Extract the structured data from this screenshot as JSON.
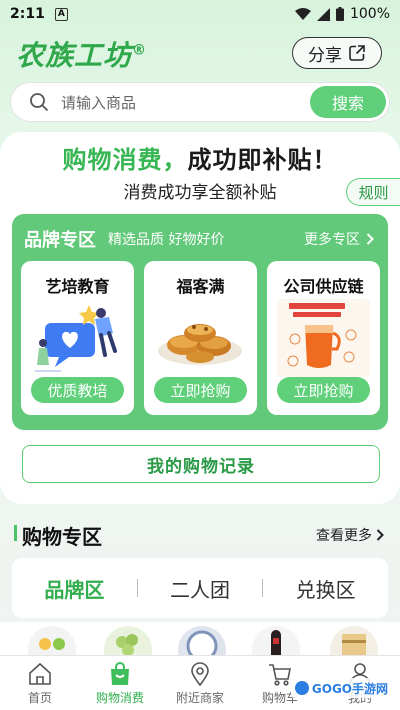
{
  "status_bar": {
    "time": "2:11",
    "notif_badge": "A",
    "battery": "100%"
  },
  "header": {
    "logo": "农族工坊",
    "logo_mark": "®",
    "share_label": "分享"
  },
  "search": {
    "placeholder": "请输入商品",
    "button_label": "搜索"
  },
  "promo": {
    "title_green": "购物消费，",
    "title_black": "成功即补贴！",
    "subtitle": "消费成功享全额补贴",
    "rules_label": "规则"
  },
  "brand_zone": {
    "title": "品牌专区",
    "subtitle": "精选品质 好物好价",
    "more_label": "更多专区",
    "cards": [
      {
        "name": "艺培教育",
        "button": "优质教培",
        "image": "education-illustration"
      },
      {
        "name": "福客满",
        "button": "立即抢购",
        "image": "pastry-plate"
      },
      {
        "name": "公司供应链",
        "button": "立即抢购",
        "image": "tea-drink-ad"
      }
    ]
  },
  "records_button": "我的购物记录",
  "shopping_zone": {
    "title": "购物专区",
    "more_label": "查看更多",
    "tabs": [
      {
        "label": "品牌区",
        "active": true
      },
      {
        "label": "二人团",
        "active": false
      },
      {
        "label": "兑换区",
        "active": false
      }
    ]
  },
  "bottom_nav": [
    {
      "label": "首页",
      "icon": "home-icon",
      "active": false
    },
    {
      "label": "购物消费",
      "icon": "shopping-bag-icon",
      "active": true
    },
    {
      "label": "附近商家",
      "icon": "location-pin-icon",
      "active": false
    },
    {
      "label": "购物车",
      "icon": "cart-icon",
      "active": false
    },
    {
      "label": "我的",
      "icon": "user-icon",
      "active": false
    }
  ],
  "watermark": "GOGO手游网",
  "colors": {
    "brand_green": "#5fd079",
    "dark_green": "#2ea84a",
    "panel_green": "#62c97a"
  }
}
